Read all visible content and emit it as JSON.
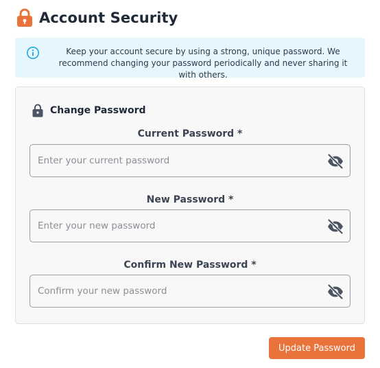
{
  "header": {
    "title": "Account Security",
    "icon": "lock-icon",
    "icon_color": "#e8743b"
  },
  "info_banner": {
    "icon": "info-circle-icon",
    "icon_color": "#1ea7e4",
    "message": "Keep your account secure by using a strong, unique password. We recommend changing your password periodically and never sharing it with others."
  },
  "form": {
    "title": "Change Password",
    "title_icon": "lock-icon",
    "fields": [
      {
        "label": "Current Password *",
        "placeholder": "Enter your current password",
        "value": "",
        "toggle_icon": "eye-slash-icon"
      },
      {
        "label": "New Password *",
        "placeholder": "Enter your new password",
        "value": "",
        "toggle_icon": "eye-slash-icon"
      },
      {
        "label": "Confirm New Password *",
        "placeholder": "Confirm your new password",
        "value": "",
        "toggle_icon": "eye-slash-icon"
      }
    ],
    "submit_label": "Update Password",
    "accent_color": "#e8743b"
  }
}
